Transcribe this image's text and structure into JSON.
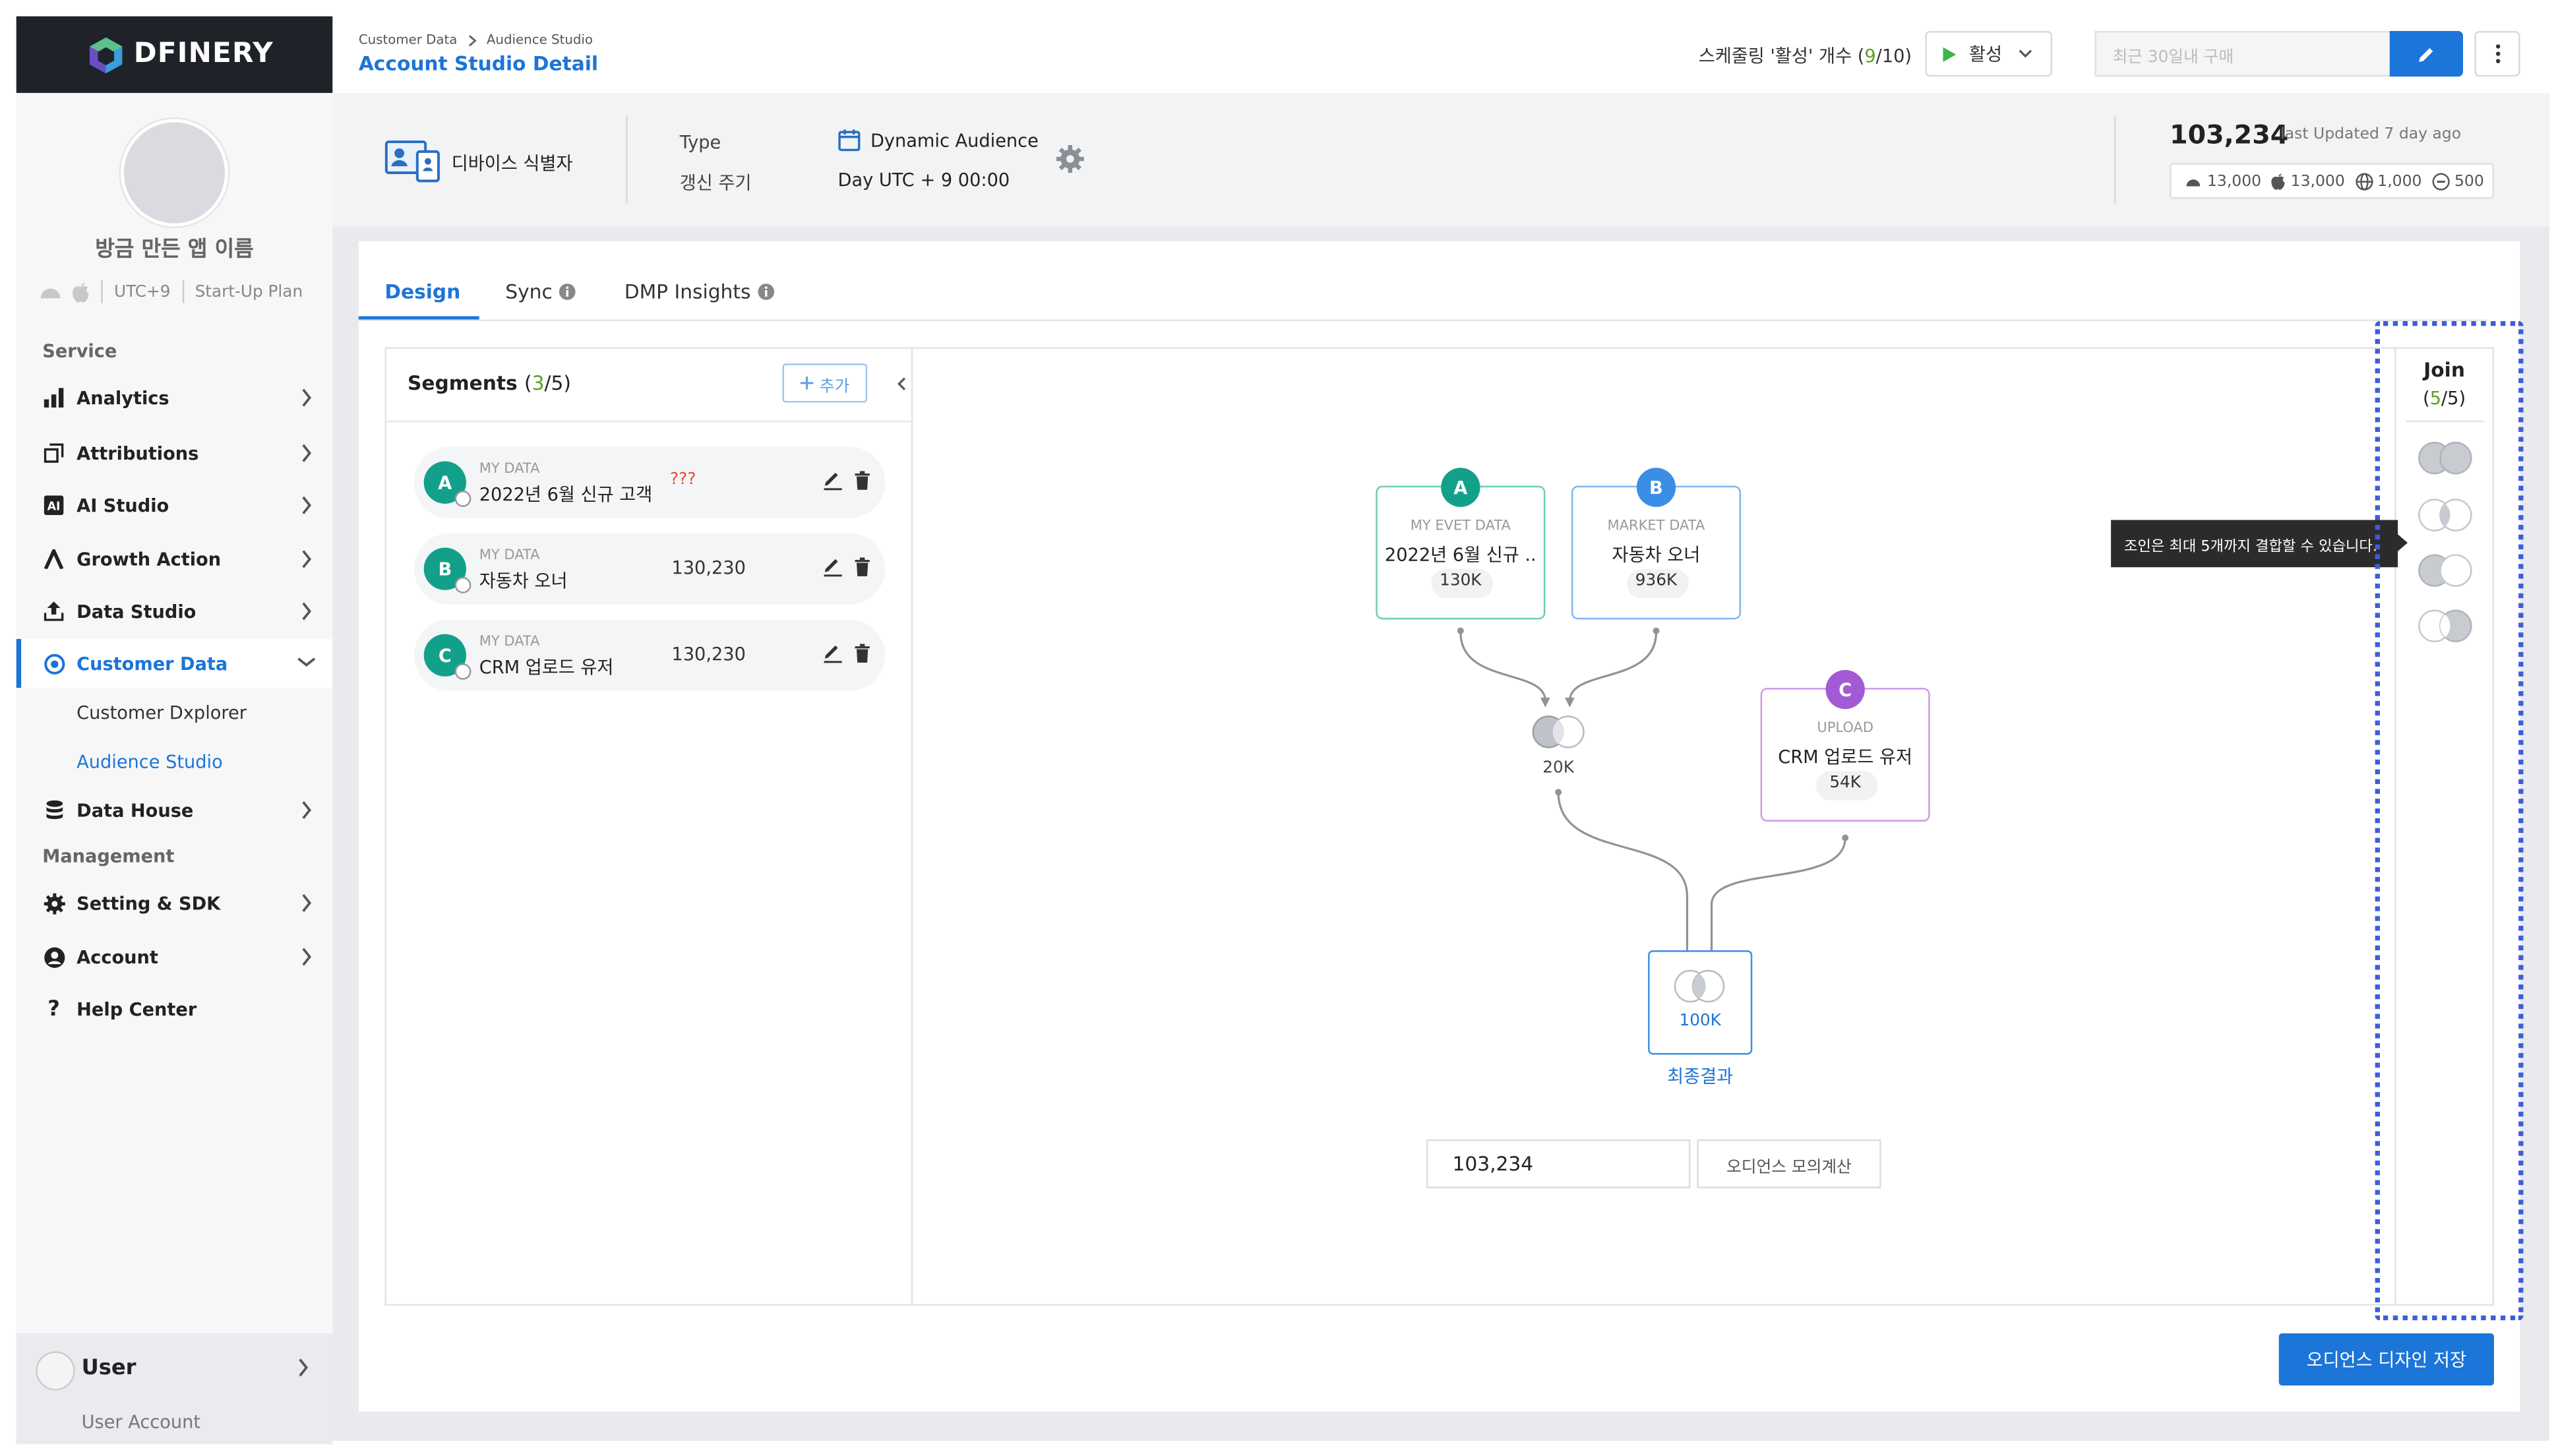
{
  "app": {
    "logo_text": "DFINERY"
  },
  "sidebar": {
    "app_name": "방금 만든 앱 이름",
    "timezone": "UTC+9",
    "plan": "Start-Up Plan",
    "service_label": "Service",
    "management_label": "Management",
    "items": [
      {
        "label": "Analytics",
        "icon": "bar-chart-icon"
      },
      {
        "label": "Attributions",
        "icon": "attribution-icon"
      },
      {
        "label": "AI Studio",
        "icon": "ai-icon"
      },
      {
        "label": "Growth Action",
        "icon": "growth-icon"
      },
      {
        "label": "Data Studio",
        "icon": "upload-icon"
      },
      {
        "label": "Customer Data",
        "icon": "target-icon"
      },
      {
        "label": "Data House",
        "icon": "database-icon"
      },
      {
        "label": "Setting & SDK",
        "icon": "gear-icon"
      },
      {
        "label": "Account",
        "icon": "user-circle-icon"
      },
      {
        "label": "Help Center",
        "icon": "question-icon"
      }
    ],
    "sub_items": [
      {
        "label": "Customer Dxplorer"
      },
      {
        "label": "Audience Studio"
      }
    ],
    "user": {
      "name": "User",
      "account": "User Account"
    }
  },
  "header": {
    "breadcrumb": [
      "Customer Data",
      "Audience Studio"
    ],
    "title": "Account Studio Detail",
    "schedule_prefix": "스케줄링 '활성' 개수 (",
    "schedule_active": "9",
    "schedule_suffix": "/10)",
    "status_label": "활성",
    "search_placeholder": "최근 30일내 구매"
  },
  "info": {
    "identifier": "디바이스 식별자",
    "type_label": "Type",
    "refresh_label": "갱신 주기",
    "audience_type": "Dynamic Audience",
    "schedule": "Day UTC + 9 00:00",
    "total": "103,234",
    "last_updated": "last Updated 7 day ago",
    "counts": {
      "android": "13,000",
      "apple": "13,000",
      "web": "1,000",
      "other": "500"
    }
  },
  "tabs": [
    {
      "label": "Design"
    },
    {
      "label": "Sync"
    },
    {
      "label": "DMP Insights"
    }
  ],
  "segments": {
    "title": "Segments",
    "count_current": "3",
    "count_total": "/5)",
    "add_label": "추가",
    "items": [
      {
        "badge": "A",
        "category": "MY DATA",
        "name": "2022년 6월 신규 고객",
        "count": "???"
      },
      {
        "badge": "B",
        "category": "MY DATA",
        "name": "자동차 오너",
        "count": "130,230"
      },
      {
        "badge": "C",
        "category": "MY DATA",
        "name": "CRM 업로드 유저",
        "count": "130,230"
      }
    ]
  },
  "canvas": {
    "nodes": [
      {
        "badge": "A",
        "category": "MY EVET DATA",
        "name": "2022년 6월 신규 ..",
        "count": "130K",
        "color": "#13a08b"
      },
      {
        "badge": "B",
        "category": "MARKET DATA",
        "name": "자동차 오너",
        "count": "936K",
        "color": "#3a8ee6"
      },
      {
        "badge": "C",
        "category": "UPLOAD",
        "name": "CRM 업로드 유저",
        "count": "54K",
        "color": "#a25bd4"
      }
    ],
    "join_count": "20K",
    "final_count": "100K",
    "final_label": "최종결과",
    "calc_value": "103,234",
    "calc_button": "오디언스 모의계산"
  },
  "join": {
    "title": "Join",
    "count_current": "5",
    "count_total": "/5)",
    "tooltip": "조인은 최대 5개까지 결합할 수 있습니다."
  },
  "footer": {
    "save_label": "오디언스 디자인 저장"
  },
  "colors": {
    "accent": "#1c75d8",
    "teal": "#13a08b",
    "purple": "#a25bd4",
    "green": "#5aa320"
  }
}
